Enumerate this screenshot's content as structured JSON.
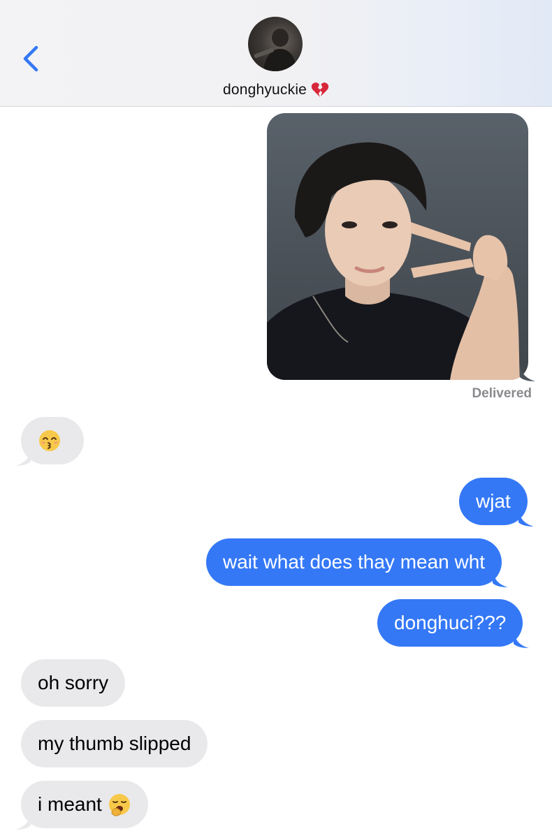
{
  "header": {
    "contact_name": "donghyuckie",
    "name_emoji": "broken-heart-icon"
  },
  "photo_message": {
    "status": "Delivered"
  },
  "messages": [
    {
      "side": "received",
      "text": "",
      "emoji": "kissing-smiling-eyes-emoji"
    },
    {
      "side": "sent",
      "text": "wjat"
    },
    {
      "side": "sent",
      "text": "wait what does thay mean wht"
    },
    {
      "side": "sent",
      "text": "donghuci???"
    },
    {
      "side": "received",
      "text": "oh sorry"
    },
    {
      "side": "received",
      "text": "my thumb slipped"
    },
    {
      "side": "received",
      "text": "i meant",
      "emoji": "yawning-face-emoji"
    }
  ],
  "colors": {
    "sent_bubble": "#3478f6",
    "received_bubble": "#e9e9eb",
    "accent": "#3478f6"
  }
}
